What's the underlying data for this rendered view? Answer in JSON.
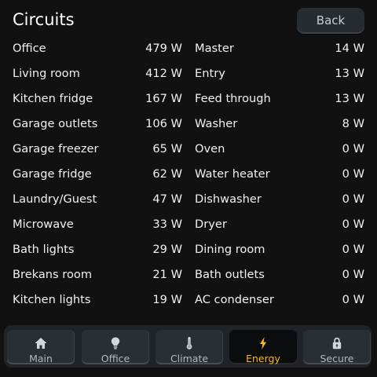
{
  "header": {
    "title": "Circuits",
    "back_label": "Back"
  },
  "circuits": {
    "left": [
      {
        "name": "Office",
        "value": "479 W"
      },
      {
        "name": "Living room",
        "value": "412 W"
      },
      {
        "name": "Kitchen fridge",
        "value": "167 W"
      },
      {
        "name": "Garage outlets",
        "value": "106 W"
      },
      {
        "name": "Garage freezer",
        "value": "65 W"
      },
      {
        "name": "Garage fridge",
        "value": "62 W"
      },
      {
        "name": "Laundry/Guest",
        "value": "47 W"
      },
      {
        "name": "Microwave",
        "value": "33 W"
      },
      {
        "name": "Bath lights",
        "value": "29 W"
      },
      {
        "name": "Brekans room",
        "value": "21 W"
      },
      {
        "name": "Kitchen lights",
        "value": "19 W"
      }
    ],
    "right": [
      {
        "name": "Master",
        "value": "14 W"
      },
      {
        "name": "Entry",
        "value": "13 W"
      },
      {
        "name": "Feed through",
        "value": "13 W"
      },
      {
        "name": "Washer",
        "value": "8 W"
      },
      {
        "name": "Oven",
        "value": "0 W"
      },
      {
        "name": "Water heater",
        "value": "0 W"
      },
      {
        "name": "Dishwasher",
        "value": "0 W"
      },
      {
        "name": "Dryer",
        "value": "0 W"
      },
      {
        "name": "Dining room",
        "value": "0 W"
      },
      {
        "name": "Bath outlets",
        "value": "0 W"
      },
      {
        "name": "AC condenser",
        "value": "0 W"
      }
    ]
  },
  "nav": {
    "active": "energy",
    "tabs": [
      {
        "id": "main",
        "label": "Main",
        "icon": "home-icon"
      },
      {
        "id": "office",
        "label": "Office",
        "icon": "lightbulb-icon"
      },
      {
        "id": "climate",
        "label": "Climate",
        "icon": "thermometer-icon"
      },
      {
        "id": "energy",
        "label": "Energy",
        "icon": "lightning-icon"
      },
      {
        "id": "secure",
        "label": "Secure",
        "icon": "lock-icon"
      }
    ]
  },
  "colors": {
    "background": "#111111",
    "text": "#f2f2f2",
    "accent": "#ffb81c",
    "tab_inactive_text": "#b4b9be",
    "tab_inactive_bg": "#2a2f34"
  }
}
